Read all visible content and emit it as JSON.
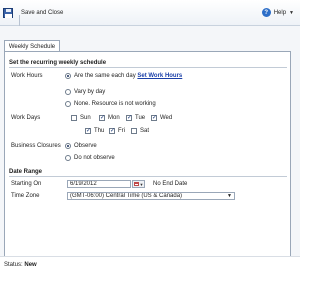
{
  "toolbar": {
    "save_close_label": "Save and Close",
    "help_label": "Help"
  },
  "tabs": [
    {
      "label": "Weekly Schedule"
    }
  ],
  "schedule": {
    "section_title": "Set the recurring weekly schedule",
    "work_hours_label": "Work Hours",
    "work_hours_options": [
      {
        "text": "Are the same each day",
        "link": "Set Work Hours",
        "selected": true
      },
      {
        "text": "Vary by day",
        "selected": false
      },
      {
        "text": "None. Resource is not working",
        "selected": false
      }
    ],
    "work_days_label": "Work Days",
    "work_days": [
      {
        "label": "Sun",
        "checked": false
      },
      {
        "label": "Mon",
        "checked": true
      },
      {
        "label": "Tue",
        "checked": true
      },
      {
        "label": "Wed",
        "checked": true
      },
      {
        "label": "Thu",
        "checked": true
      },
      {
        "label": "Fri",
        "checked": true
      },
      {
        "label": "Sat",
        "checked": false
      }
    ],
    "business_closures_label": "Business Closures",
    "business_closures_options": [
      {
        "text": "Observe",
        "selected": true
      },
      {
        "text": "Do not observe",
        "selected": false
      }
    ]
  },
  "date_range": {
    "section_title": "Date Range",
    "starting_on_label": "Starting On",
    "starting_on_value": "6/19/2012",
    "end_date_text": "No End Date",
    "time_zone_label": "Time Zone",
    "time_zone_value": "(GMT-06:00) Central Time (US & Canada)"
  },
  "status": {
    "label": "Status:",
    "value": "New"
  }
}
